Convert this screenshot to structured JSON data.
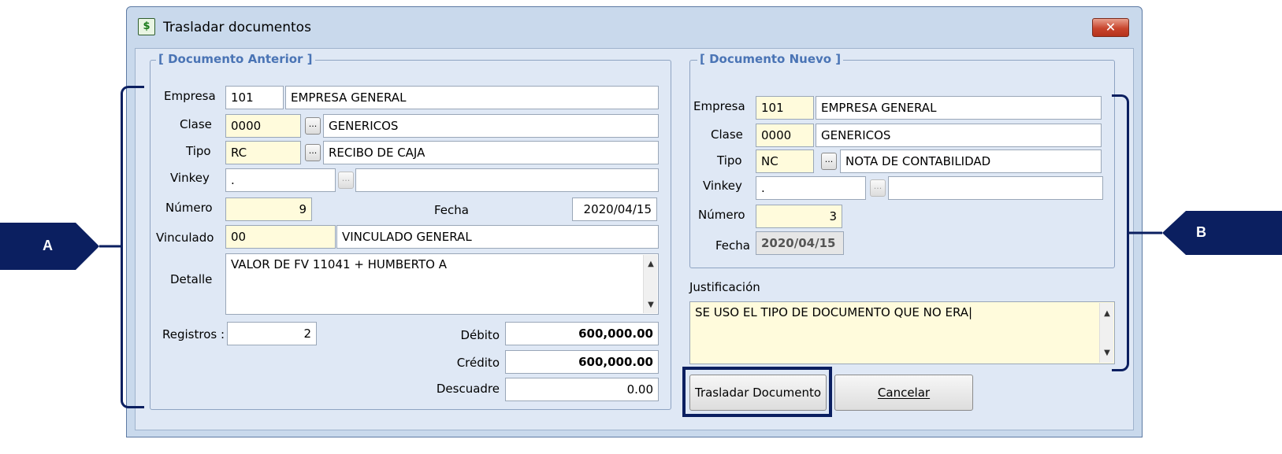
{
  "window": {
    "title": "Trasladar documentos",
    "close_icon": "✕",
    "app_icon": "$"
  },
  "anterior": {
    "group_title": "[ Documento Anterior ]",
    "empresa": {
      "label": "Empresa",
      "code": "101",
      "name": "EMPRESA GENERAL"
    },
    "clase": {
      "label": "Clase",
      "code": "0000",
      "name": "GENERICOS"
    },
    "tipo": {
      "label": "Tipo",
      "code": "RC",
      "name": "RECIBO DE CAJA"
    },
    "vinkey": {
      "label": "Vinkey",
      "code": ".",
      "name": ""
    },
    "numero": {
      "label": "Número",
      "value": "9"
    },
    "fecha": {
      "label": "Fecha",
      "value": "2020/04/15"
    },
    "vinculado": {
      "label": "Vinculado",
      "code": "00",
      "name": "VINCULADO GENERAL"
    },
    "detalle": {
      "label": "Detalle",
      "value": "VALOR DE FV 11041 + HUMBERTO A"
    },
    "registros": {
      "label": "Registros :",
      "value": "2"
    },
    "debito": {
      "label": "Débito",
      "value": "600,000.00"
    },
    "credito": {
      "label": "Crédito",
      "value": "600,000.00"
    },
    "descuadre": {
      "label": "Descuadre",
      "value": "0.00"
    }
  },
  "nuevo": {
    "group_title": "[ Documento Nuevo ]",
    "empresa": {
      "label": "Empresa",
      "code": "101",
      "name": "EMPRESA GENERAL"
    },
    "clase": {
      "label": "Clase",
      "code": "0000",
      "name": "GENERICOS"
    },
    "tipo": {
      "label": "Tipo",
      "code": "NC",
      "name": "NOTA DE CONTABILIDAD"
    },
    "vinkey": {
      "label": "Vinkey",
      "code": ".",
      "name": ""
    },
    "numero": {
      "label": "Número",
      "value": "3"
    },
    "fecha": {
      "label": "Fecha",
      "value": "2020/04/15"
    }
  },
  "justificacion": {
    "label": "Justificación",
    "value": "SE USO EL TIPO DE DOCUMENTO QUE NO ERA|"
  },
  "buttons": {
    "trasladar": "Trasladar Documento",
    "cancelar": "Cancelar"
  },
  "ellipsis": "...",
  "scroll_up": "▲",
  "scroll_down": "▼",
  "callouts": {
    "a": "A",
    "b": "B"
  },
  "colors": {
    "callout": "#0b1f60",
    "group_title": "#4a74b5",
    "field_yellow": "#fffbdc"
  }
}
